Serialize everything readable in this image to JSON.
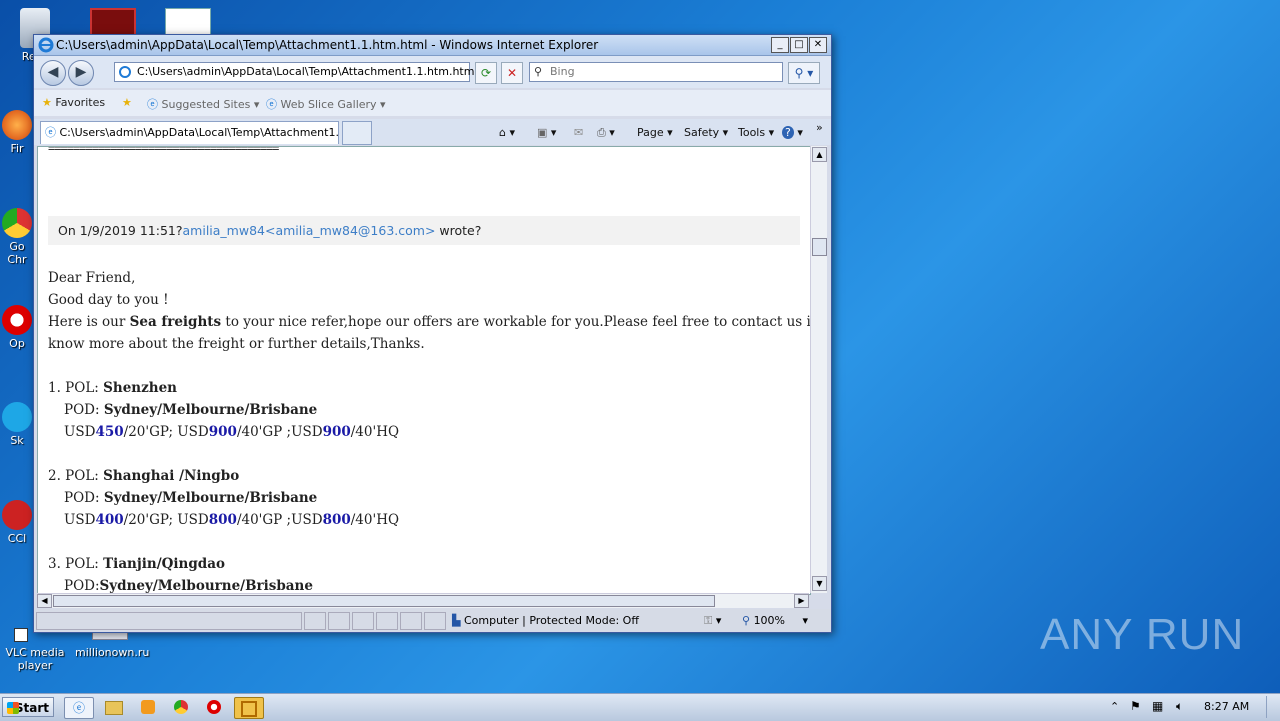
{
  "desktop": {
    "icons": [
      {
        "label": "Recy"
      },
      {
        "label": "Fir"
      },
      {
        "label": "Go Chr"
      },
      {
        "label": "Op"
      },
      {
        "label": "Sk"
      },
      {
        "label": "CCl"
      },
      {
        "label": "VLC media player"
      },
      {
        "label": "millionown.ru"
      }
    ]
  },
  "window": {
    "title": "C:\\Users\\admin\\AppData\\Local\\Temp\\Attachment1.1.htm.html - Windows Internet Explorer",
    "buttons": {
      "minimize": "_",
      "maximize": "□",
      "close": "✕"
    }
  },
  "address": {
    "url": "C:\\Users\\admin\\AppData\\Local\\Temp\\Attachment1.1.htm.html",
    "search_placeholder": "Bing"
  },
  "favorites_bar": {
    "favorites_label": "Favorites",
    "suggested_sites": "Suggested Sites",
    "web_slice_gallery": "Web Slice Gallery"
  },
  "tab": {
    "label": "C:\\Users\\admin\\AppData\\Local\\Temp\\Attachment1.1...."
  },
  "command_bar": {
    "page": "Page",
    "safety": "Safety",
    "tools": "Tools"
  },
  "content": {
    "separator": "=====================================",
    "quote_header": {
      "prefix": "On 1/9/2019 11:51?",
      "link": "amilia_mw84<amilia_mw84@163.com>",
      "suffix": " wrote?"
    },
    "greeting": "Dear Friend,",
    "good_day": "Good day to you !",
    "intro_pre": "Here is our ",
    "intro_bold": "Sea freights",
    "intro_post": " to your nice refer,hope our offers are workable for you.Please feel free to contact us if you want to",
    "intro_line2": "know more about the freight or further details,Thanks.",
    "offers": [
      {
        "index": "1. POL: ",
        "pol": "Shenzhen",
        "pod_label": "POD: ",
        "pod": "Sydney/Melbourne/Brisbane",
        "rate_a": "450",
        "rate_b": "900",
        "rate_c": "900"
      },
      {
        "index": "2. POL: ",
        "pol": "Shanghai /Ningbo",
        "pod_label": "POD: ",
        "pod": "Sydney/Melbourne/Brisbane",
        "rate_a": "400",
        "rate_b": "800",
        "rate_c": "800"
      },
      {
        "index": "3. POL: ",
        "pol": "Tianjin/Qingdao",
        "pod_label": "POD:",
        "pod": "Sydney/Melbourne/Brisbane"
      }
    ],
    "rate_text": {
      "usd": "USD",
      "gp20": "/20'GP; USD",
      "gp40": "/40'GP ;USD",
      "hq40": "/40'HQ"
    }
  },
  "status_bar": {
    "zone": "Computer | Protected Mode: Off",
    "zoom": "100%"
  },
  "taskbar": {
    "start": "Start",
    "time": "8:27 AM"
  },
  "watermark": "ANY RUN"
}
